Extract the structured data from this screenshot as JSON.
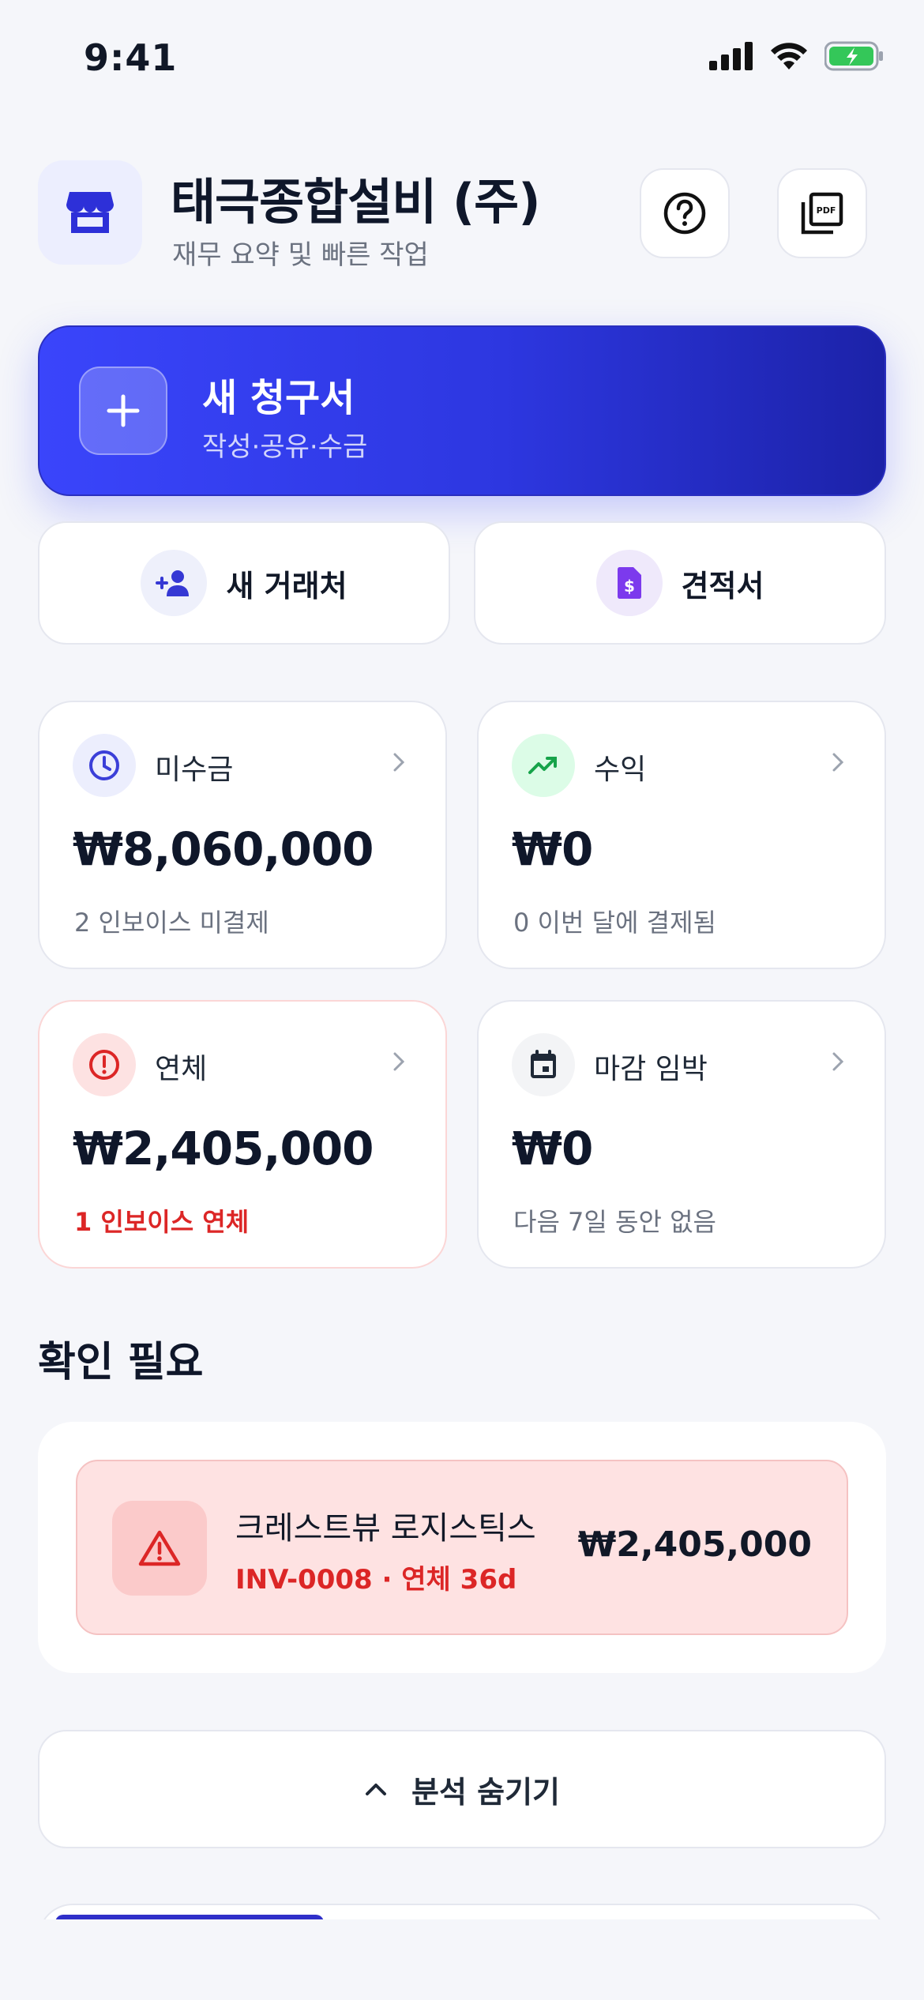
{
  "status_bar": {
    "time": "9:41"
  },
  "header": {
    "company_name": "태극종합설비 (주)",
    "subtitle": "재무 요약 및 빠른 작업",
    "help_icon": "help-circle-icon",
    "pdf_icon": "pdf-icon"
  },
  "new_invoice": {
    "title": "새 청구서",
    "subtitle": "작성·공유·수금"
  },
  "quick_actions": [
    {
      "label": "새 거래처",
      "icon": "add-person-icon"
    },
    {
      "label": "견적서",
      "icon": "estimate-document-icon"
    }
  ],
  "cards": [
    {
      "label": "미수금",
      "amount": "₩8,060,000",
      "note": "2 인보이스 미결제",
      "icon": "clock-icon",
      "accent": "#3b3fd8"
    },
    {
      "label": "수익",
      "amount": "₩0",
      "note": "0 이번 달에 결제됨",
      "icon": "trend-up-icon",
      "accent": "#16a34a"
    },
    {
      "label": "연체",
      "amount": "₩2,405,000",
      "note": "1 인보이스 연체",
      "icon": "alert-circle-icon",
      "accent": "#dc2626"
    },
    {
      "label": "마감 임박",
      "amount": "₩0",
      "note": "다음 7일 동안 없음",
      "icon": "calendar-icon",
      "accent": "#1f2937"
    }
  ],
  "attention": {
    "title": "확인 필요",
    "items": [
      {
        "client": "크레스트뷰 로지스틱스",
        "meta": "INV-0008 · 연체 36d",
        "amount": "₩2,405,000",
        "icon": "warning-triangle-icon"
      }
    ]
  },
  "toggle_analysis": {
    "label": "분석 숨기기",
    "icon": "chevron-up-icon"
  },
  "colors": {
    "primary": "#3a45fb",
    "danger": "#dc2626",
    "success": "#16a34a",
    "background": "#f5f6fa"
  }
}
